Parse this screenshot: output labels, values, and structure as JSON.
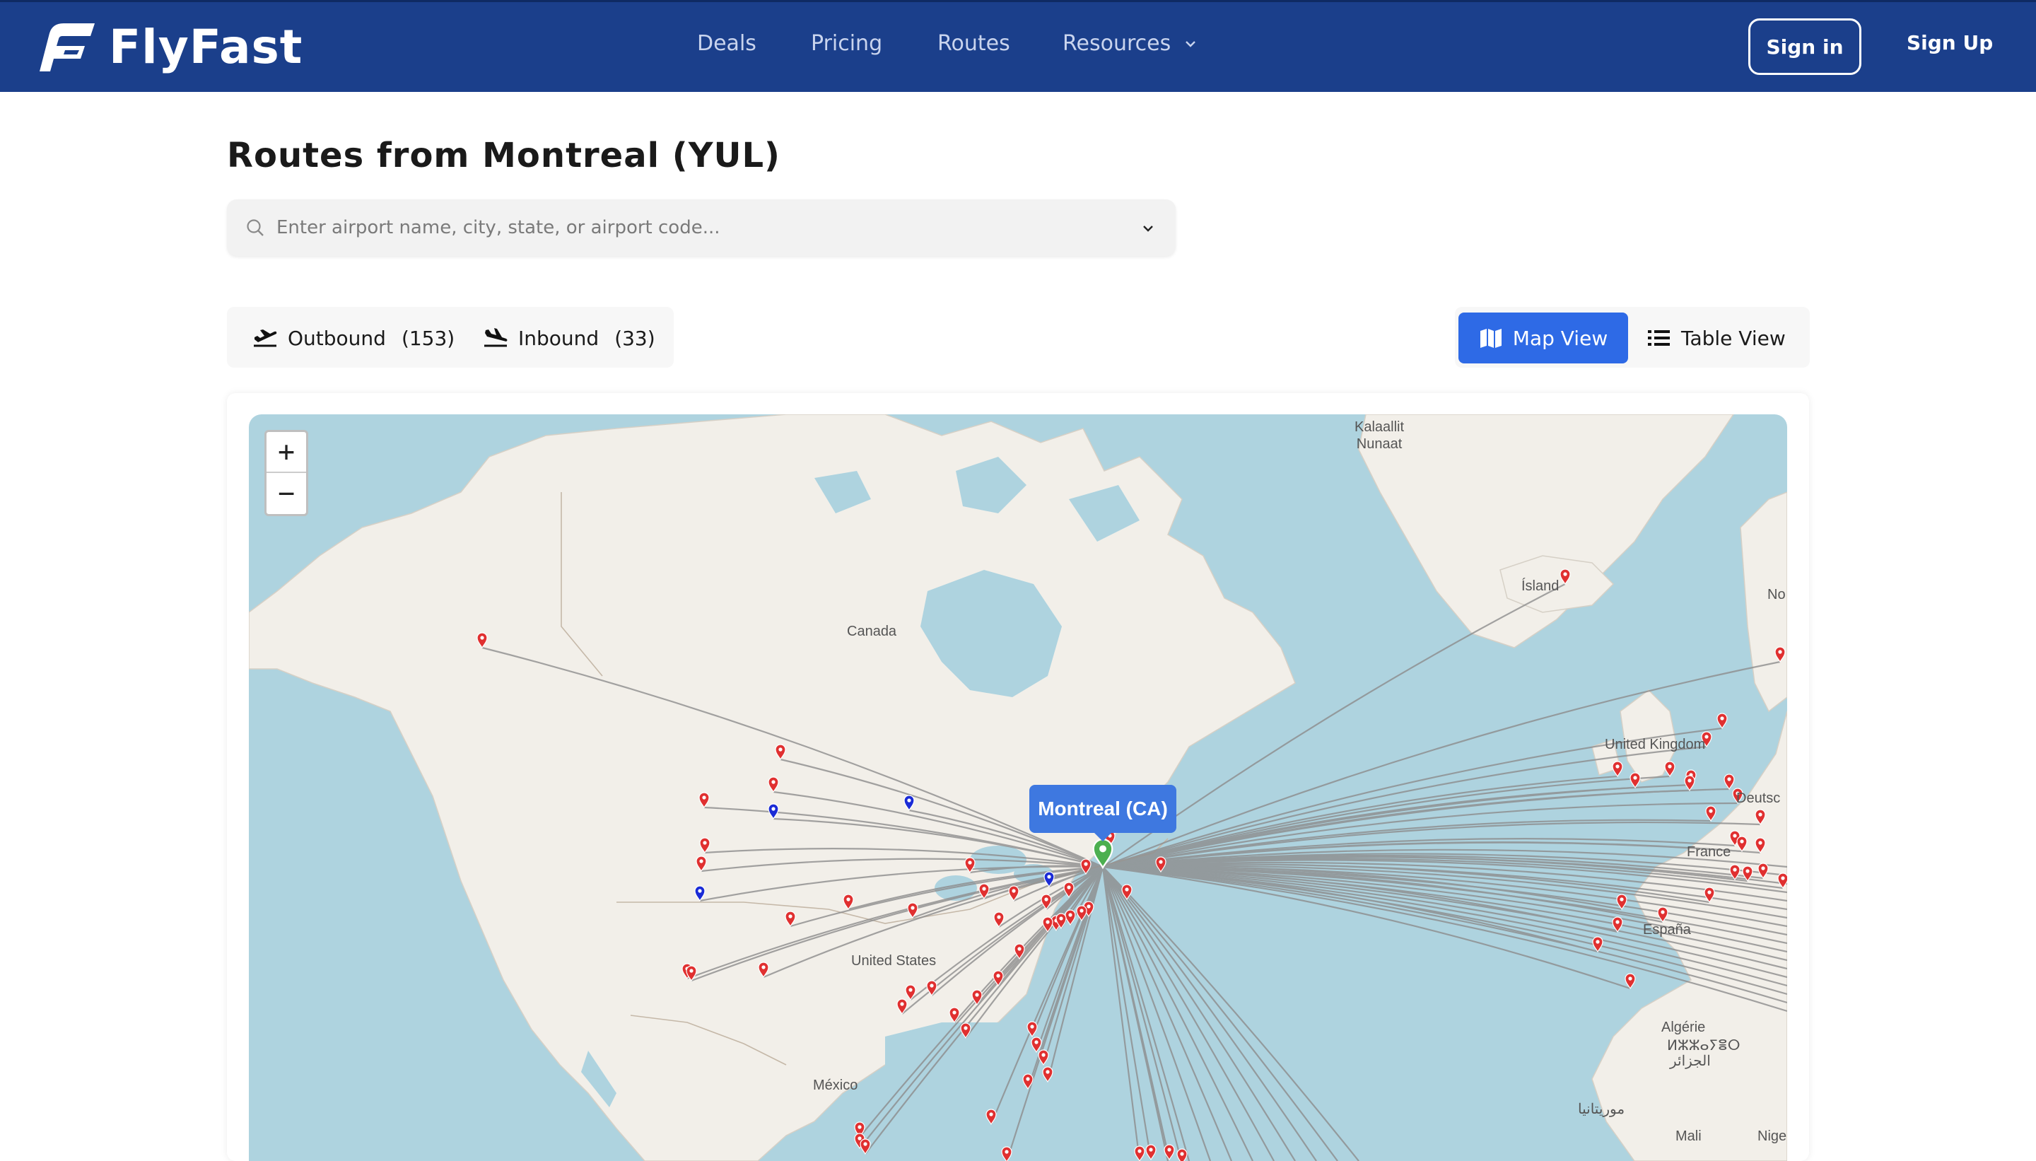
{
  "brand": {
    "name": "FlyFast",
    "color": "#1b3f8b"
  },
  "nav": {
    "deals": "Deals",
    "pricing": "Pricing",
    "routes": "Routes",
    "resources": "Resources",
    "signin": "Sign in",
    "signup": "Sign Up"
  },
  "page": {
    "title": "Routes from Montreal (YUL)"
  },
  "search": {
    "placeholder": "Enter airport name, city, state, or airport code..."
  },
  "direction_tabs": {
    "outbound_label": "Outbound",
    "outbound_count": "(153)",
    "inbound_label": "Inbound",
    "inbound_count": "(33)"
  },
  "view_tabs": {
    "map_view": "Map View",
    "table_view": "Table View",
    "active": "map",
    "active_color": "#2e6ae6"
  },
  "map": {
    "zoom_in": "+",
    "zoom_out": "−",
    "tooltip": "Montreal (CA)",
    "labels": {
      "greenland_1": "Kalaallit",
      "greenland_2": "Nunaat",
      "iceland": "Ísland",
      "canada": "Canada",
      "united_states": "United States",
      "united_kingdom": "United Kingdom",
      "mexico": "México",
      "france": "France",
      "espana": "España",
      "algerie": "Algérie",
      "algerie_tifinagh": "ⵍⵣⵣⴰⵢⴻⵔ",
      "algerie_ar": "الجزائر",
      "deutschland": "Deutsc",
      "norge": "No",
      "mali": "Mali",
      "niger": "Nige",
      "morocco_ar": "موريتانيا"
    },
    "colors": {
      "outbound_pin": "#e03030",
      "inbound_pin": "#1a2bd6",
      "origin_pin": "#4caf50",
      "route_line": "#888888"
    }
  }
}
